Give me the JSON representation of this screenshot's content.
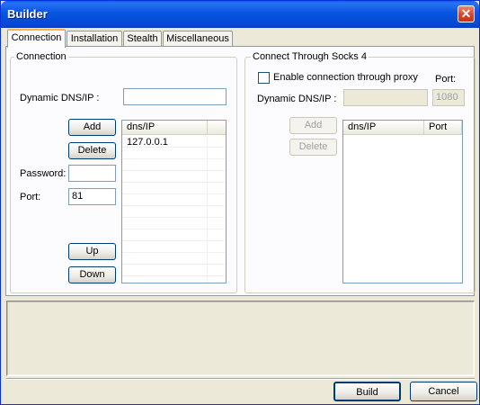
{
  "window": {
    "title": "Builder",
    "close_symbol": "✕"
  },
  "tabs": [
    {
      "label": "Connection",
      "active": true
    },
    {
      "label": "Installation",
      "active": false
    },
    {
      "label": "Stealth",
      "active": false
    },
    {
      "label": "Miscellaneous",
      "active": false
    }
  ],
  "connection": {
    "group_title": "Connection",
    "dns_label": "Dynamic DNS/IP :",
    "dns_value": "",
    "add_label": "Add",
    "delete_label": "Delete",
    "password_label": "Password:",
    "password_value": "",
    "port_label": "Port:",
    "port_value": "81",
    "up_label": "Up",
    "down_label": "Down",
    "list_header": "dns/IP",
    "list_items": [
      "127.0.0.1"
    ]
  },
  "socks": {
    "group_title": "Connect Through Socks 4",
    "enable_label": "Enable connection through proxy",
    "enable_checked": false,
    "port_label": "Port:",
    "dns_label": "Dynamic DNS/IP :",
    "dns_value": "",
    "port_value": "1080",
    "add_label": "Add",
    "delete_label": "Delete",
    "list_header_dns": "dns/IP",
    "list_header_port": "Port"
  },
  "status_text": "",
  "footer": {
    "build_label": "Build",
    "cancel_label": "Cancel"
  }
}
